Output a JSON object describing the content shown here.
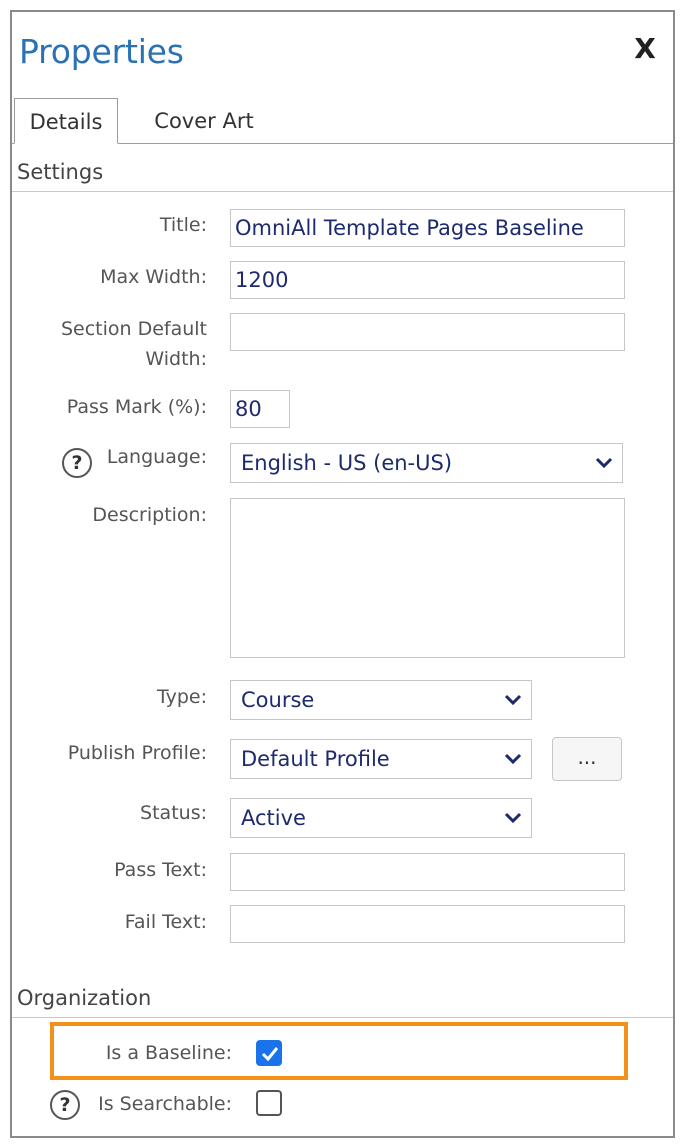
{
  "panel": {
    "title": "Properties",
    "close_label": "X"
  },
  "tabs": [
    {
      "label": "Details",
      "active": true
    },
    {
      "label": "Cover Art",
      "active": false
    }
  ],
  "settings": {
    "header": "Settings",
    "title": {
      "label": "Title:",
      "value": "OmniAll Template Pages Baseline"
    },
    "max_width": {
      "label": "Max Width:",
      "value": "1200"
    },
    "section_default_width": {
      "label_line1": "Section Default",
      "label_line2": "Width:",
      "value": ""
    },
    "pass_mark": {
      "label": "Pass Mark (%):",
      "value": "80"
    },
    "language": {
      "label": "Language:",
      "value": "English - US (en-US)"
    },
    "description": {
      "label": "Description:",
      "value": ""
    },
    "type": {
      "label": "Type:",
      "value": "Course"
    },
    "publish_profile": {
      "label": "Publish Profile:",
      "value": "Default Profile",
      "button_label": "..."
    },
    "status": {
      "label": "Status:",
      "value": "Active"
    },
    "pass_text": {
      "label": "Pass Text:",
      "value": ""
    },
    "fail_text": {
      "label": "Fail Text:",
      "value": ""
    }
  },
  "organization": {
    "header": "Organization",
    "is_baseline": {
      "label": "Is a Baseline:",
      "checked": true
    },
    "is_searchable": {
      "label": "Is Searchable:",
      "checked": false
    }
  },
  "icons": {
    "close": "close-icon",
    "help": "help-icon",
    "chevron": "chevron-down-icon",
    "check": "checkmark-icon"
  },
  "colors": {
    "title": "#2b72b5",
    "highlight": "#f2901c",
    "checkbox": "#1a73e8",
    "input_text": "#1e2a6e"
  }
}
